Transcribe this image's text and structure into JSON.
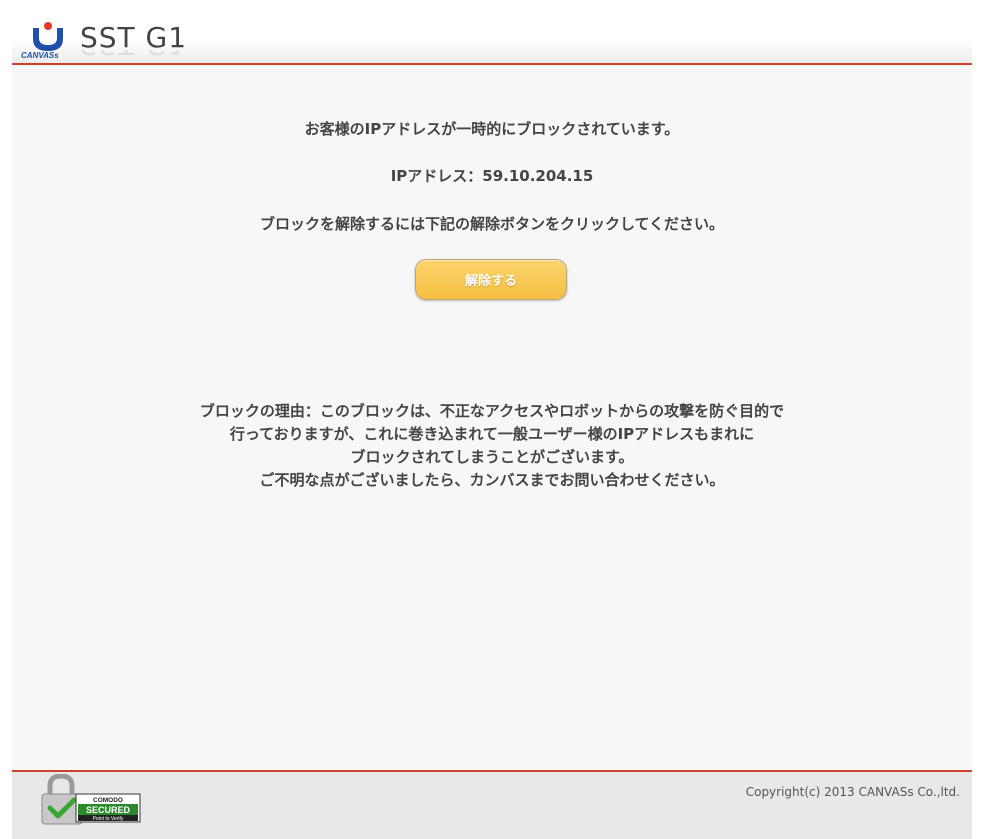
{
  "header": {
    "brand_small": "CANVASs",
    "product_name": "SST G1"
  },
  "main": {
    "line1": "お客様のIPアドレスが一時的にブロックされています。",
    "ip_line": "IPアドレス：59.10.204.15",
    "line3": "ブロックを解除するには下記の解除ボタンをクリックしてください。",
    "unblock_button": "解除する",
    "reason": [
      "ブロックの理由：このブロックは、不正なアクセスやロボットからの攻撃を防ぐ目的で",
      "行っておりますが、これに巻き込まれて一般ユーザー様のIPアドレスもまれに",
      "ブロックされてしまうことがございます。",
      "ご不明な点がございましたら、カンバスまでお問い合わせください。"
    ]
  },
  "footer": {
    "seal_line1": "COMODO",
    "seal_line2": "SECURED",
    "seal_line3": "Point to Verify",
    "copyright": "Copyright(c) 2013 CANVASs Co.,ltd."
  },
  "colors": {
    "accent_red": "#d0402a",
    "button_yellow": "#f5bf42",
    "logo_blue": "#1f4fa8"
  }
}
